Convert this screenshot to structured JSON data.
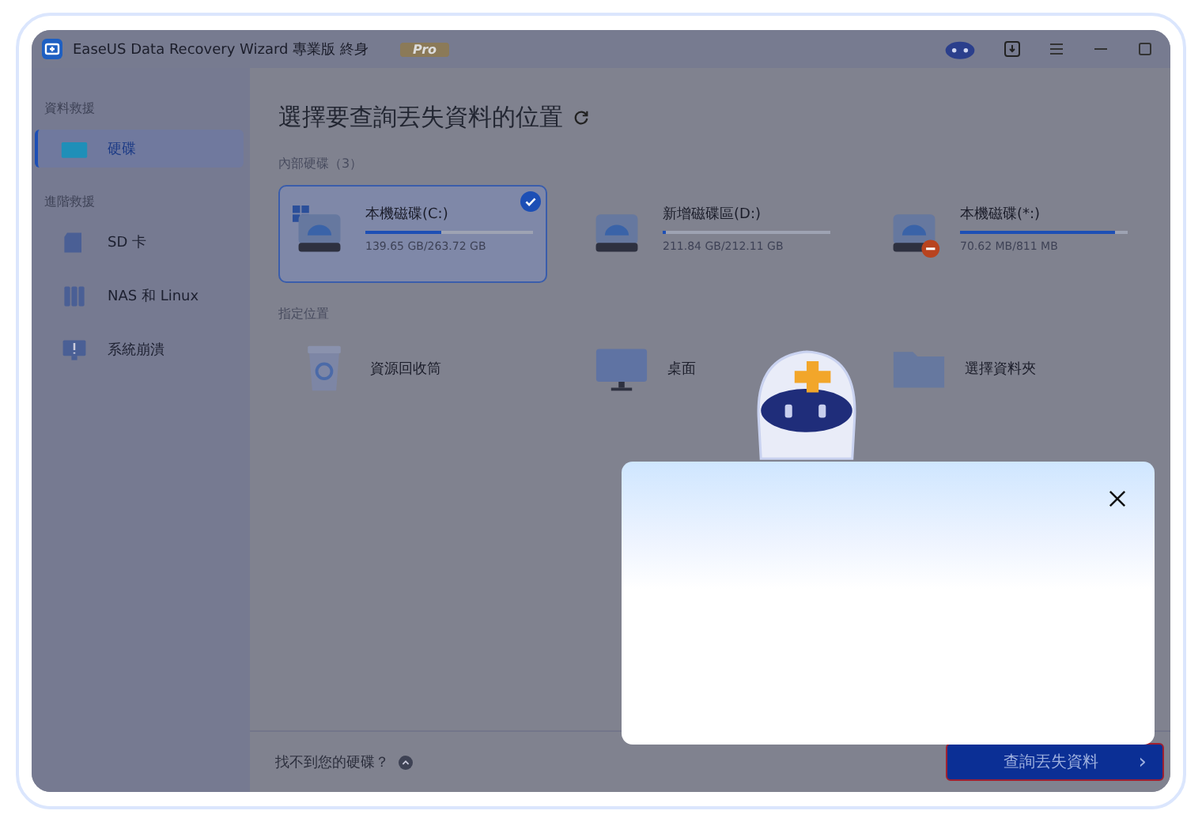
{
  "window": {
    "title": "EaseUS Data Recovery Wizard 專業版 終身",
    "badge": "Pro"
  },
  "sidebar": {
    "sections": [
      {
        "heading": "資料救援",
        "items": [
          {
            "label": "硬碟",
            "kind": "drive",
            "selected": true
          }
        ]
      },
      {
        "heading": "進階救援",
        "items": [
          {
            "label": "SD 卡",
            "kind": "sd",
            "selected": false
          },
          {
            "label": "NAS 和 Linux",
            "kind": "nas",
            "selected": false
          },
          {
            "label": "系統崩潰",
            "kind": "crash",
            "selected": false
          }
        ]
      }
    ]
  },
  "main": {
    "title": "選擇要查詢丟失資料的位置",
    "drives_heading": "內部硬碟（3）",
    "drives": [
      {
        "name": "本機磁碟(C:)",
        "size": "139.65 GB/263.72 GB",
        "level": 0.45,
        "selected": true,
        "kind": "system"
      },
      {
        "name": "新增磁碟區(D:)",
        "size": "211.84 GB/212.11 GB",
        "level": 0.02,
        "selected": false,
        "kind": "plain"
      },
      {
        "name": "本機磁碟(*:)",
        "size": "70.62 MB/811 MB",
        "level": 0.92,
        "selected": false,
        "kind": "error"
      }
    ],
    "locations_heading": "指定位置",
    "locations": [
      {
        "label": "資源回收筒",
        "kind": "recycle"
      },
      {
        "label": "桌面",
        "kind": "desktop"
      },
      {
        "label": "選擇資料夾",
        "kind": "folder"
      }
    ]
  },
  "footer": {
    "hint": "找不到您的硬碟？",
    "button": "查詢丟失資料",
    "button_arrow": "›"
  }
}
